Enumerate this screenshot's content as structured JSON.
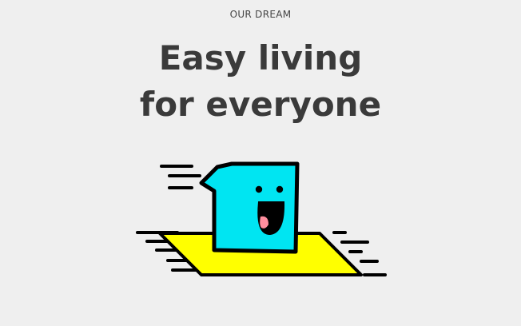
{
  "hero": {
    "eyebrow": "OUR DREAM",
    "headline_line1": "Easy living",
    "headline_line2": "for everyone"
  },
  "colors": {
    "background": "#efefef",
    "text": "#3a3a3a",
    "mascot_body": "#00e5f2",
    "carpet": "#ffff00",
    "outline": "#000000",
    "tongue": "#ff8f9f"
  },
  "icons": {
    "illustration": "flying-carpet-mascot-icon"
  }
}
